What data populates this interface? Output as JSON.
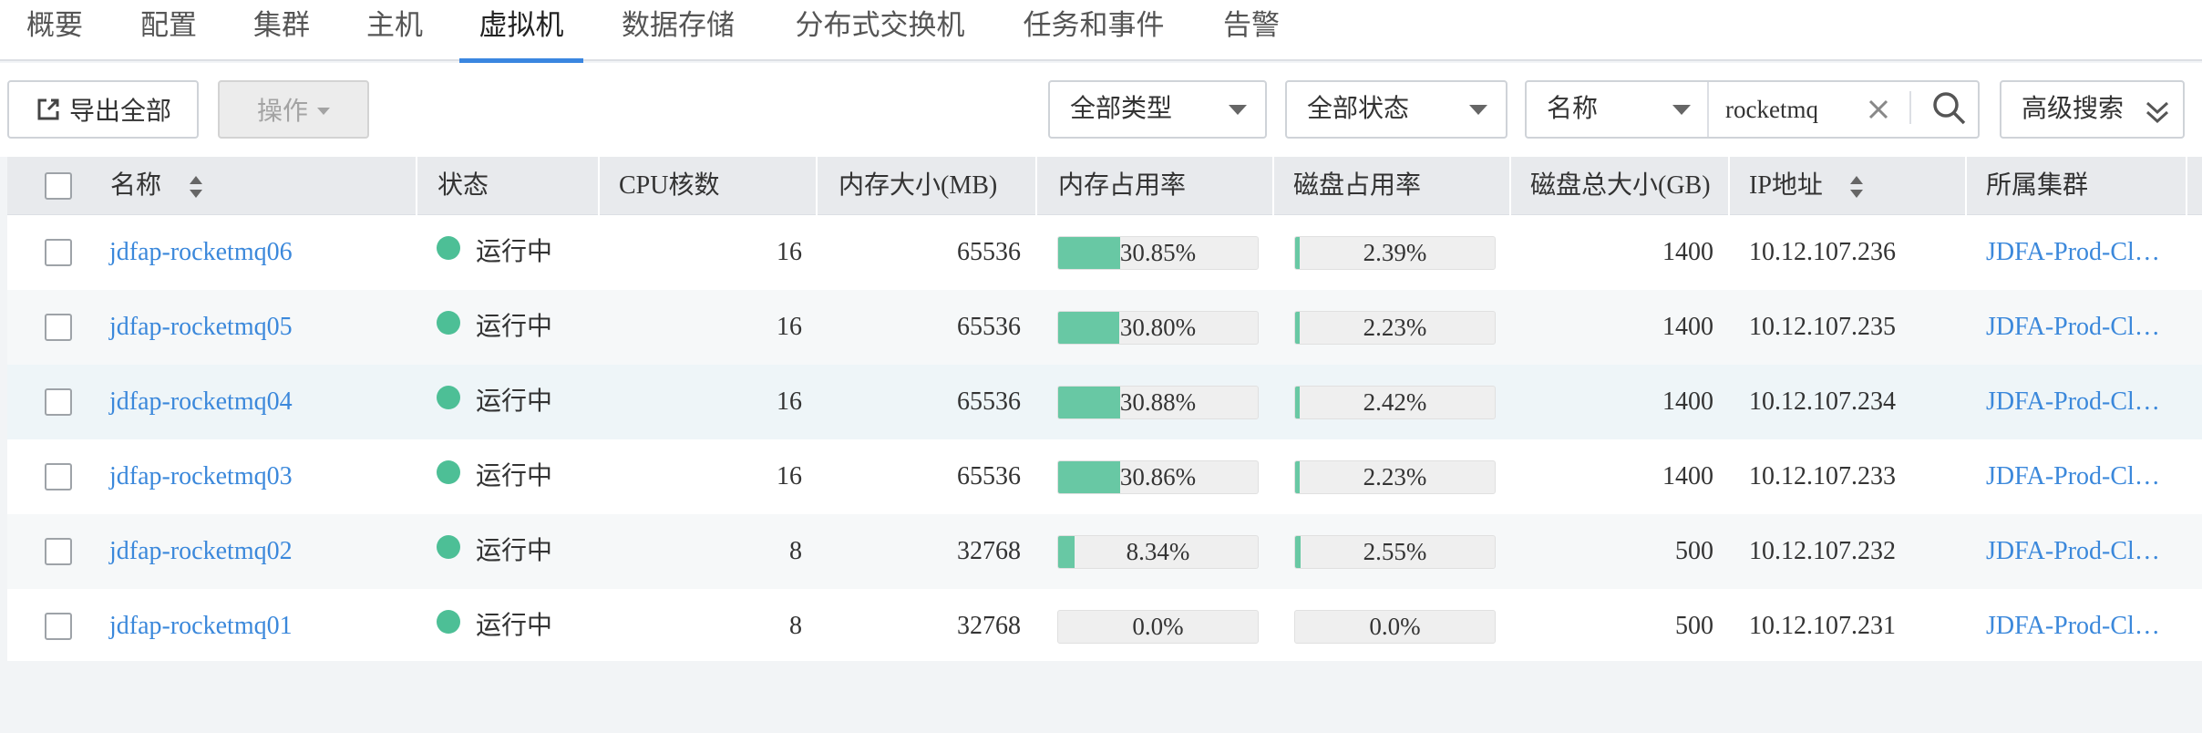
{
  "tabs": [
    {
      "label": "概要"
    },
    {
      "label": "配置"
    },
    {
      "label": "集群"
    },
    {
      "label": "主机"
    },
    {
      "label": "虚拟机",
      "active": true
    },
    {
      "label": "数据存储"
    },
    {
      "label": "分布式交换机"
    },
    {
      "label": "任务和事件"
    },
    {
      "label": "告警"
    }
  ],
  "toolbar": {
    "export_label": "导出全部",
    "actions_label": "操作",
    "type_filter": "全部类型",
    "status_filter": "全部状态",
    "search_field": "名称",
    "search_value": "rocketmq",
    "advanced_label": "高级搜索"
  },
  "table": {
    "columns": [
      "名称",
      "状态",
      "CPU核数",
      "内存大小(MB)",
      "内存占用率",
      "磁盘占用率",
      "磁盘总大小(GB)",
      "IP地址",
      "所属集群"
    ],
    "rows": [
      {
        "name": "jdfap-rocketmq06",
        "status": "运行中",
        "cpu": "16",
        "mem": "65536",
        "mem_usage": "30.85%",
        "mem_pct": 30.85,
        "disk_usage": "2.39%",
        "disk_pct": 2.39,
        "disk_total": "1400",
        "ip": "10.12.107.236",
        "cluster": "JDFA-Prod-Cl…"
      },
      {
        "name": "jdfap-rocketmq05",
        "status": "运行中",
        "cpu": "16",
        "mem": "65536",
        "mem_usage": "30.80%",
        "mem_pct": 30.8,
        "disk_usage": "2.23%",
        "disk_pct": 2.23,
        "disk_total": "1400",
        "ip": "10.12.107.235",
        "cluster": "JDFA-Prod-Cl…"
      },
      {
        "name": "jdfap-rocketmq04",
        "status": "运行中",
        "cpu": "16",
        "mem": "65536",
        "mem_usage": "30.88%",
        "mem_pct": 30.88,
        "disk_usage": "2.42%",
        "disk_pct": 2.42,
        "disk_total": "1400",
        "ip": "10.12.107.234",
        "cluster": "JDFA-Prod-Cl…"
      },
      {
        "name": "jdfap-rocketmq03",
        "status": "运行中",
        "cpu": "16",
        "mem": "65536",
        "mem_usage": "30.86%",
        "mem_pct": 30.86,
        "disk_usage": "2.23%",
        "disk_pct": 2.23,
        "disk_total": "1400",
        "ip": "10.12.107.233",
        "cluster": "JDFA-Prod-Cl…"
      },
      {
        "name": "jdfap-rocketmq02",
        "status": "运行中",
        "cpu": "8",
        "mem": "32768",
        "mem_usage": "8.34%",
        "mem_pct": 8.34,
        "disk_usage": "2.55%",
        "disk_pct": 2.55,
        "disk_total": "500",
        "ip": "10.12.107.232",
        "cluster": "JDFA-Prod-Cl…"
      },
      {
        "name": "jdfap-rocketmq01",
        "status": "运行中",
        "cpu": "8",
        "mem": "32768",
        "mem_usage": "0.0%",
        "mem_pct": 0.0,
        "disk_usage": "0.0%",
        "disk_pct": 0.0,
        "disk_total": "500",
        "ip": "10.12.107.231",
        "cluster": "JDFA-Prod-Cl…"
      }
    ]
  },
  "colors": {
    "accent": "#3a86e0",
    "link": "#3b88db",
    "running": "#4dbf96",
    "usage_bar": "#68c8a4"
  },
  "icons": [
    "export-icon",
    "clear-icon",
    "search-icon",
    "double-chevron-down-icon",
    "sort-icon",
    "running-status-icon"
  ]
}
